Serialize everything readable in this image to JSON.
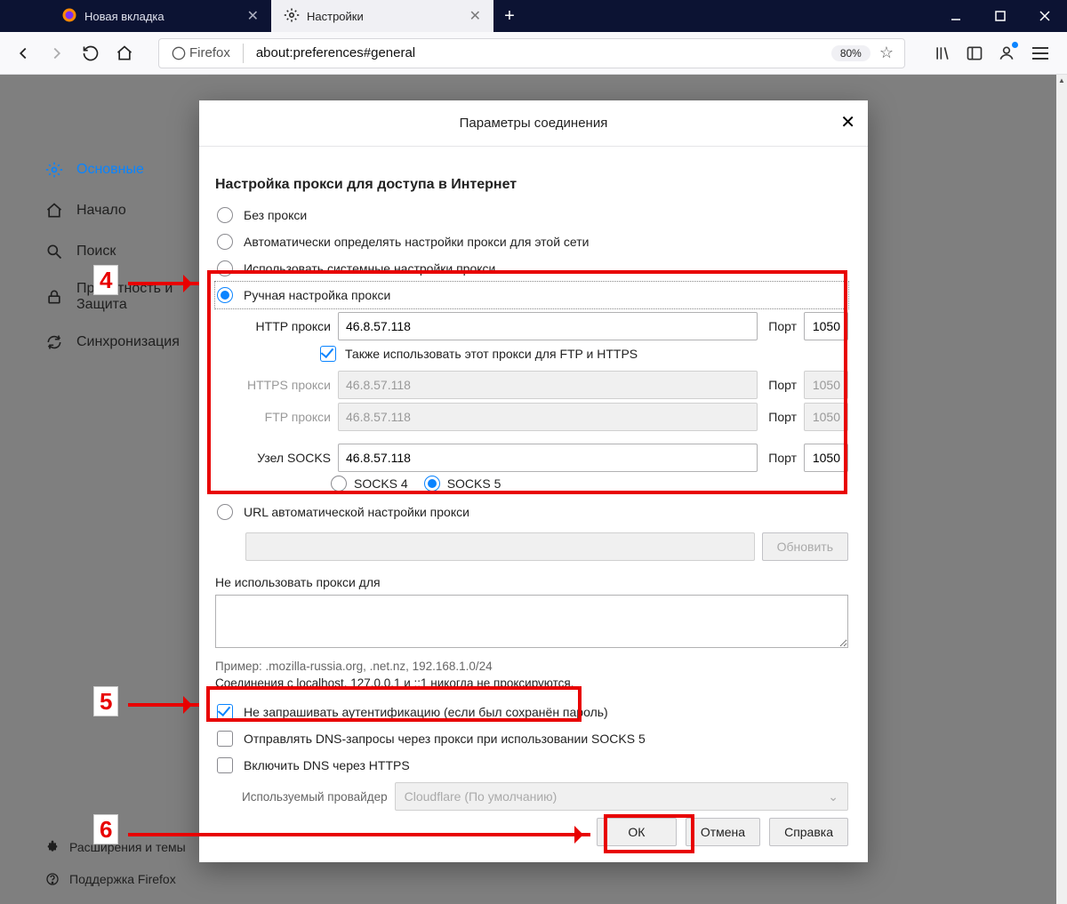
{
  "tabs": {
    "t0_label": "Новая вкладка",
    "t1_label": "Настройки"
  },
  "toolbar": {
    "fx_label": "Firefox",
    "url": "about:preferences#general",
    "zoom": "80%"
  },
  "sidebar": {
    "general": "Основные",
    "home": "Начало",
    "search": "Поиск",
    "privacy_l1": "Приватность и",
    "privacy_l2": "Защита",
    "sync": "Синхронизация",
    "ext": "Расширения и темы",
    "support": "Поддержка Firefox"
  },
  "dialog": {
    "title": "Параметры соединения",
    "section": "Настройка прокси для доступа в Интернет",
    "r_none": "Без прокси",
    "r_auto": "Автоматически определять настройки прокси для этой сети",
    "r_sys": "Использовать системные настройки прокси",
    "r_manual": "Ручная настройка прокси",
    "lbl_http": "HTTP прокси",
    "lbl_https": "HTTPS прокси",
    "lbl_ftp": "FTP прокси",
    "lbl_socks": "Узел SOCKS",
    "lbl_port": "Порт",
    "val_http_host": "46.8.57.118",
    "val_http_port": "1050",
    "val_https_host": "46.8.57.118",
    "val_https_port": "1050",
    "val_ftp_host": "46.8.57.118",
    "val_ftp_port": "1050",
    "val_socks_host": "46.8.57.118",
    "val_socks_port": "1050",
    "cb_also": "Также использовать этот прокси для FTP и HTTPS",
    "socks4": "SOCKS 4",
    "socks5": "SOCKS 5",
    "r_pac": "URL автоматической настройки прокси",
    "btn_refresh": "Обновить",
    "noproxy_label": "Не использовать прокси для",
    "example": "Пример: .mozilla-russia.org, .net.nz, 192.168.1.0/24",
    "localhost_note": "Соединения с localhost, 127.0.0.1 и ::1 никогда не проксируются.",
    "cb_noauth": "Не запрашивать аутентификацию (если был сохранён пароль)",
    "cb_dns_socks": "Отправлять DNS-запросы через прокси при использовании SOCKS 5",
    "cb_dns_https": "Включить DNS через HTTPS",
    "provider_label": "Используемый провайдер",
    "provider_value": "Cloudflare (По умолчанию)",
    "btn_ok": "ОК",
    "btn_cancel": "Отмена",
    "btn_help": "Справка"
  },
  "annot": {
    "n4": "4",
    "n5": "5",
    "n6": "6"
  }
}
